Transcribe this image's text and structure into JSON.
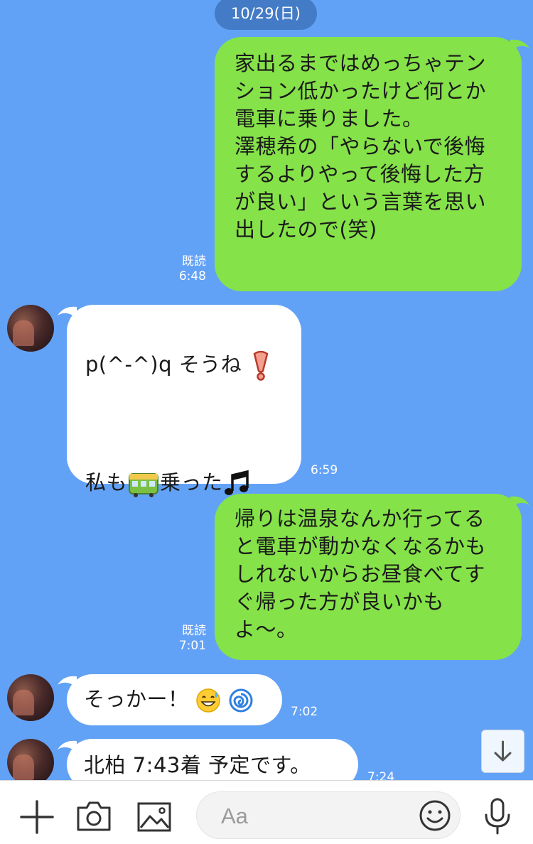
{
  "date_label": "10/29(日)",
  "messages": [
    {
      "text": "家出るまではめっちゃテン\nション低かったけど何とか\n電車に乗りました。\n澤穂希の「やらないで後悔\nするよりやって後悔した方\nが良い」という言葉を思い\n出したので(笑)",
      "read": "既読",
      "time": "6:48"
    },
    {
      "line1": "p(^-^)q  そうね",
      "line2a": "私も",
      "line2b": "乗った",
      "time": "6:59"
    },
    {
      "text": "帰りは温泉なんか行ってる\nと電車が動かなくなるかも\nしれないからお昼食べてす\nぐ帰った方が良いかも\nよ〜。",
      "read": "既読",
      "time": "7:01"
    },
    {
      "text": "そっかー！",
      "time": "7:02"
    },
    {
      "text": "北柏  7:43着  予定です。",
      "time": "7:24"
    }
  ],
  "input": {
    "placeholder": "Aa"
  },
  "icons": [
    "plus-icon",
    "camera-icon",
    "image-icon",
    "emoji-icon",
    "mic-icon",
    "scroll-down-icon",
    "exclamation-emoji",
    "train-emoji",
    "music-notes-emoji",
    "sweat-smile-emoji",
    "cyclone-emoji"
  ],
  "colors": {
    "background": "#62a2f6",
    "outgoing": "#85e249",
    "incoming": "#ffffff"
  }
}
